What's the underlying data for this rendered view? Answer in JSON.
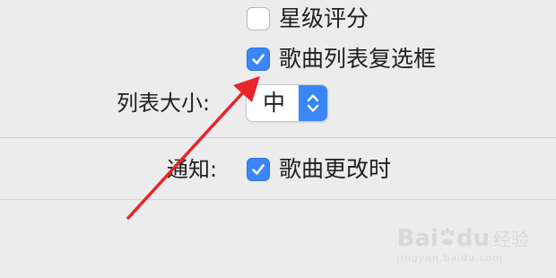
{
  "options": {
    "star_rating": {
      "label": "星级评分",
      "checked": false
    },
    "song_list_checkbox": {
      "label": "歌曲列表复选框",
      "checked": true
    }
  },
  "list_size": {
    "label": "列表大小:",
    "value": "中"
  },
  "notifications": {
    "label": "通知:",
    "option": {
      "label": "歌曲更改时",
      "checked": true
    }
  },
  "annotation": {
    "color": "#e8232a"
  },
  "watermark": {
    "brand": "Bai",
    "brand_suffix": "du",
    "cn": "经验",
    "url": "jingyan.baidu.com"
  },
  "colors": {
    "accent": "#3a86f6",
    "background": "#ececec"
  }
}
